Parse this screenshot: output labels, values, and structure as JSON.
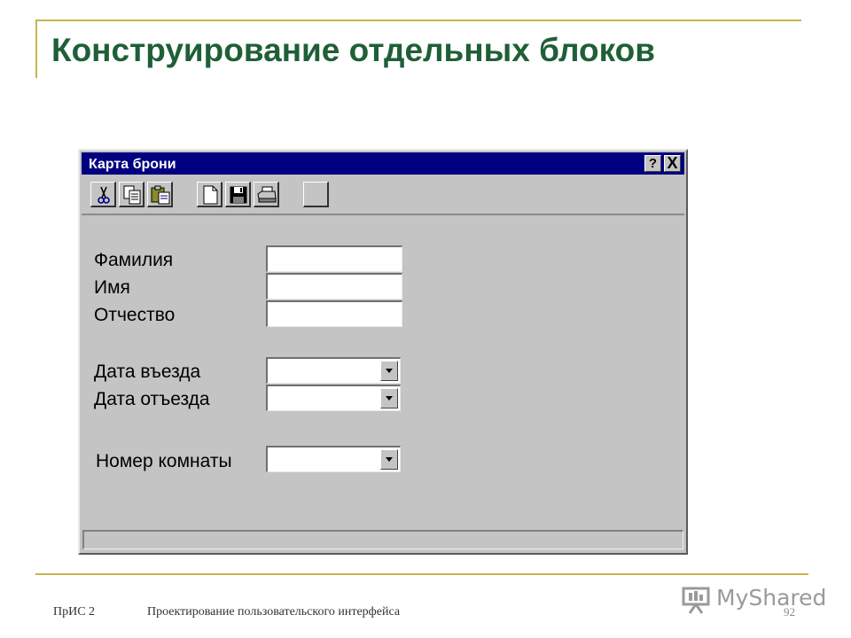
{
  "slide": {
    "title": "Конструирование отдельных блоков",
    "footer_left": "ПрИС 2",
    "footer_center": "Проектирование пользовательского интерфейса",
    "page_number": "92",
    "watermark": "MyShared",
    "accent_color": "#c8b44a",
    "title_color": "#1f5f37"
  },
  "dialog": {
    "title": "Карта брони",
    "help_label": "?",
    "close_label": "X",
    "titlebar_color": "#000080",
    "toolbar": [
      {
        "name": "cut",
        "icon": "scissors-icon"
      },
      {
        "name": "copy",
        "icon": "copy-icon"
      },
      {
        "name": "paste",
        "icon": "paste-icon"
      },
      {
        "name": "new",
        "icon": "new-document-icon"
      },
      {
        "name": "save",
        "icon": "floppy-disk-icon"
      },
      {
        "name": "print",
        "icon": "printer-icon"
      },
      {
        "name": "blank",
        "icon": ""
      }
    ],
    "fields": {
      "surname_label": "Фамилия",
      "surname_value": "",
      "name_label": "Имя",
      "name_value": "",
      "patronymic_label": "Отчество",
      "patronymic_value": "",
      "arrival_label": "Дата въезда",
      "arrival_value": "",
      "departure_label": "Дата отъезда",
      "departure_value": "",
      "room_label": "Номер комнаты",
      "room_value": ""
    }
  }
}
